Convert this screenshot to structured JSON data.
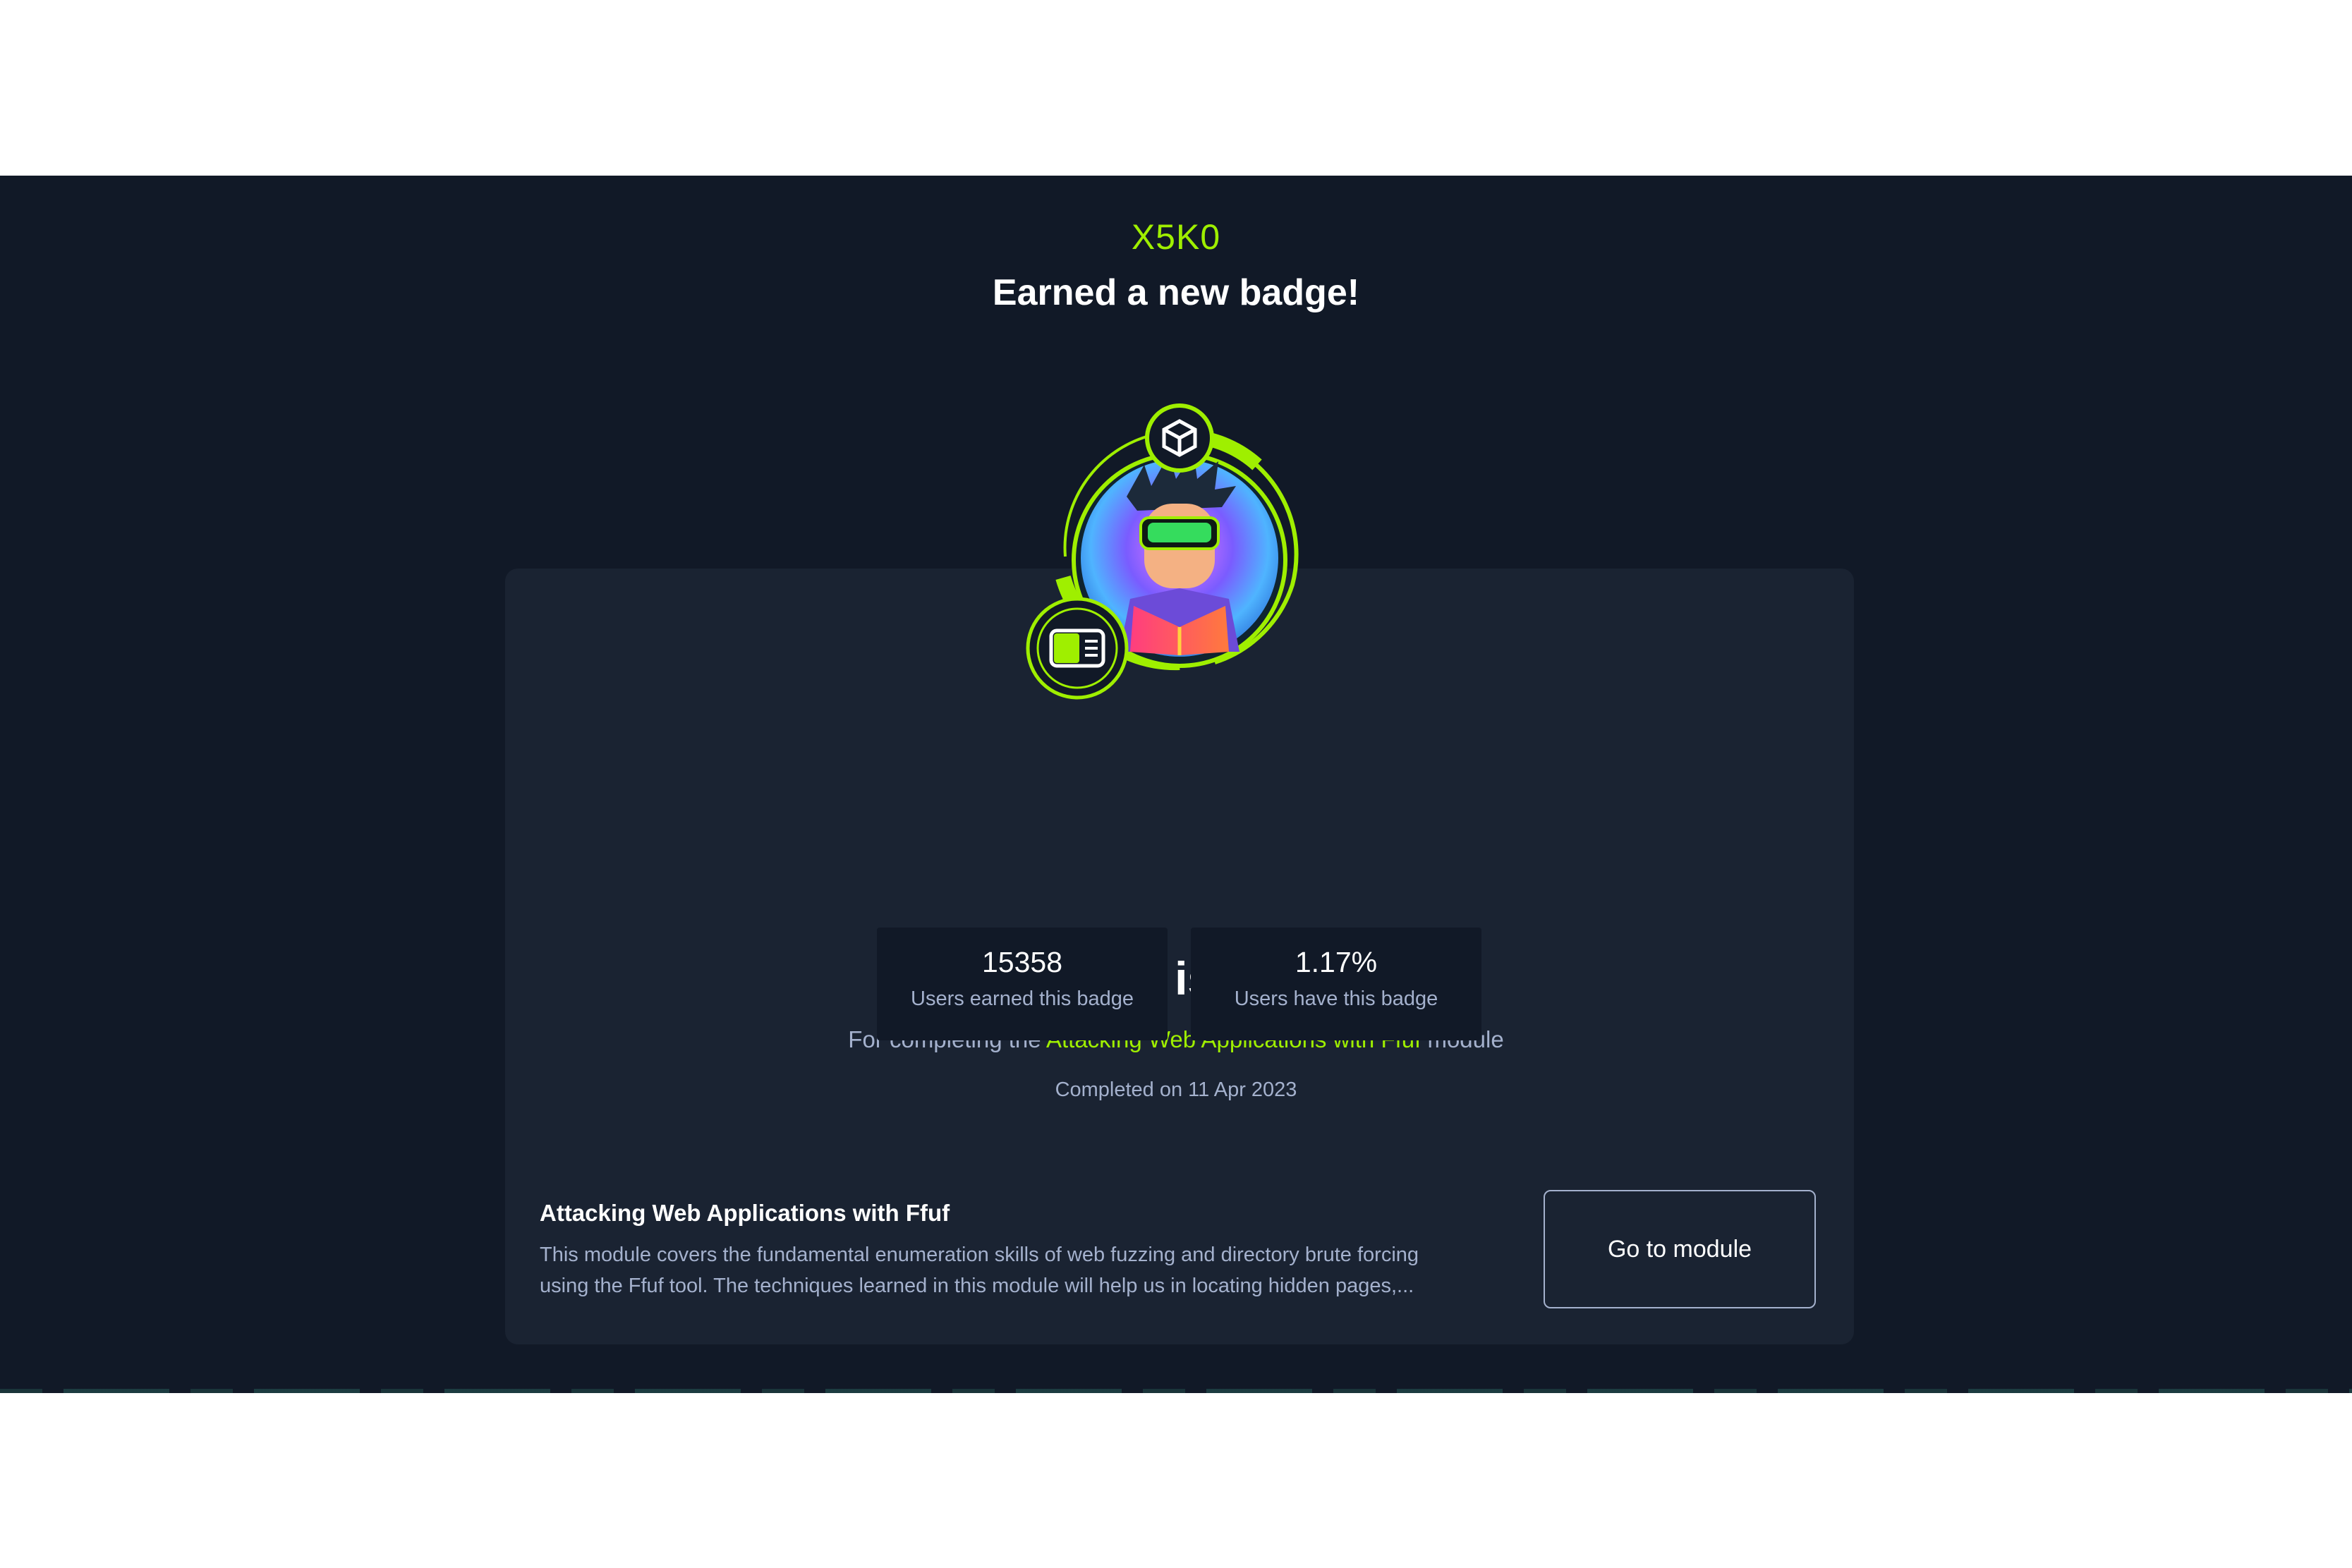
{
  "header": {
    "username": "X5K0",
    "headline": "Earned a new badge!"
  },
  "badge": {
    "title": "Fuzzing is power",
    "subtitle_prefix": "For completing the",
    "subtitle_link": "Attacking Web Applications with Ffuf",
    "subtitle_suffix": "module",
    "icons": [
      "cube-icon",
      "module-card-icon"
    ]
  },
  "stats": [
    {
      "value": "15358",
      "label": "Users earned this badge"
    },
    {
      "value": "1.17%",
      "label": "Users have this badge"
    }
  ],
  "completed": "Completed on 11 Apr 2023",
  "module": {
    "title": "Attacking Web Applications with Ffuf",
    "description": "This module covers the fundamental enumeration skills of web fuzzing and directory brute forcing using the Ffuf tool. The techniques learned in this module will help us in locating hidden pages,...",
    "button_label": "Go to module"
  },
  "colors": {
    "accent": "#9fef00",
    "background": "#111927",
    "card": "#1a2332",
    "muted_text": "#a4b1cd"
  }
}
